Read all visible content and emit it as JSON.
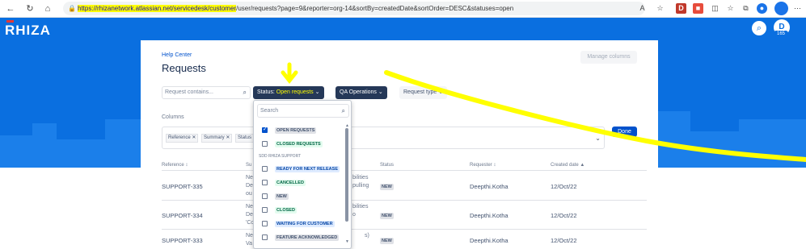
{
  "browser": {
    "url_highlight": "https://rhizanetwork.atlassian.net/servicedesk/customer",
    "url_rest": "/user/requests?page=9&reporter=org-14&sortBy=createdDate&sortOrder=DESC&statuses=open",
    "ext_d_label": "D",
    "avatar_initial": ""
  },
  "banner": {
    "logo": "RHIZA",
    "user_initial": "D",
    "user_count": "165"
  },
  "card": {
    "help_center": "Help Center",
    "title": "Requests",
    "manage_columns": "Manage columns",
    "search_placeholder": "Request contains...",
    "status_label": "Status:",
    "status_value": "Open requests",
    "qa_operations": "QA Operations",
    "request_type": "Request type",
    "columns_label": "Columns",
    "column_tags": [
      "Reference",
      "Summary",
      "Status"
    ],
    "done": "Done"
  },
  "table": {
    "headers": {
      "reference": "Reference",
      "summary": "Su",
      "status": "Status",
      "requester": "Requester",
      "created": "Created date"
    },
    "rows": [
      {
        "ref": "SUPPORT-335",
        "summary_lines": [
          "Ne",
          "De",
          "ou"
        ],
        "summary_tail": [
          "bilities",
          "pulling",
          ""
        ],
        "status": "NEW",
        "requester": "Deepthi.Kotha",
        "created": "12/Oct/22"
      },
      {
        "ref": "SUPPORT-334",
        "summary_lines": [
          "Ne",
          "De",
          "'Co"
        ],
        "summary_tail": [
          "bilities",
          "o",
          ""
        ],
        "status": "NEW",
        "requester": "Deepthi.Kotha",
        "created": "12/Oct/22"
      },
      {
        "ref": "SUPPORT-333",
        "summary_lines": [
          "Ne",
          "Va"
        ],
        "summary_tail": [
          "s)",
          ""
        ],
        "status": "NEW",
        "requester": "Deepthi.Kotha",
        "created": "12/Oct/22"
      }
    ]
  },
  "dropdown": {
    "search_placeholder": "Search",
    "group_label": "SDD RHIZA SUPPORT",
    "items_top": [
      {
        "label": "OPEN REQUESTS",
        "checked": true,
        "color": "grey"
      },
      {
        "label": "CLOSED REQUESTS",
        "checked": false,
        "color": "green"
      }
    ],
    "items_group": [
      {
        "label": "READY FOR NEXT RELEASE",
        "checked": false,
        "color": "blue"
      },
      {
        "label": "CANCELLED",
        "checked": false,
        "color": "green"
      },
      {
        "label": "NEW",
        "checked": false,
        "color": "grey"
      },
      {
        "label": "CLOSED",
        "checked": false,
        "color": "green"
      },
      {
        "label": "WAITING FOR CUSTOMER",
        "checked": false,
        "color": "blue"
      },
      {
        "label": "FEATURE ACKNOWLEDGED",
        "checked": false,
        "color": "grey"
      }
    ]
  },
  "colors": {
    "banner": "#0a6fe0",
    "annotation": "#ffff00",
    "primary": "#0052cc",
    "dark_button": "#253858"
  }
}
